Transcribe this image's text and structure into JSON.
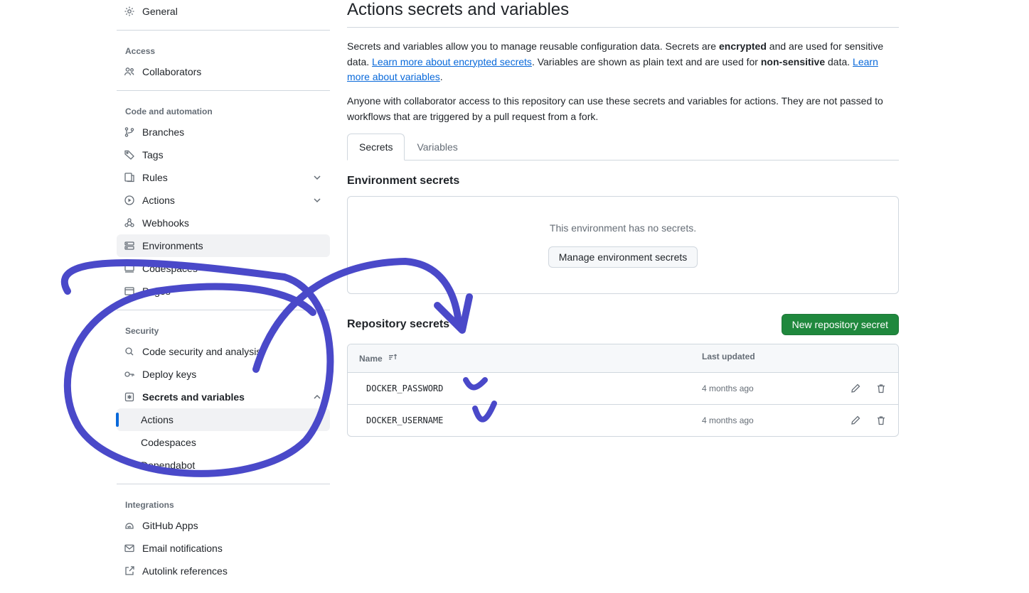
{
  "sidebar": {
    "general": "General",
    "access_heading": "Access",
    "collaborators": "Collaborators",
    "code_heading": "Code and automation",
    "branches": "Branches",
    "tags": "Tags",
    "rules": "Rules",
    "actions": "Actions",
    "webhooks": "Webhooks",
    "environments": "Environments",
    "codespaces": "Codespaces",
    "pages": "Pages",
    "security_heading": "Security",
    "code_security": "Code security and analysis",
    "deploy_keys": "Deploy keys",
    "secrets_vars": "Secrets and variables",
    "sub_actions": "Actions",
    "sub_codespaces": "Codespaces",
    "sub_dependabot": "Dependabot",
    "integrations_heading": "Integrations",
    "github_apps": "GitHub Apps",
    "email_notifications": "Email notifications",
    "autolink": "Autolink references"
  },
  "main": {
    "title": "Actions secrets and variables",
    "p1a": "Secrets and variables allow you to manage reusable configuration data. Secrets are ",
    "p1b_strong": "encrypted",
    "p1c": " and are used for sensitive data. ",
    "p1_link1": "Learn more about encrypted secrets",
    "p1d": ". Variables are shown as plain text and are used for ",
    "p1e_strong": "non-sensitive",
    "p1f": " data. ",
    "p1_link2": "Learn more about variables",
    "p1g": ".",
    "p2": "Anyone with collaborator access to this repository can use these secrets and variables for actions. They are not passed to workflows that are triggered by a pull request from a fork.",
    "tab_secrets": "Secrets",
    "tab_vars": "Variables",
    "env_heading": "Environment secrets",
    "env_empty": "This environment has no secrets.",
    "env_btn": "Manage environment secrets",
    "repo_heading": "Repository secrets",
    "new_secret_btn": "New repository secret",
    "th_name": "Name",
    "th_updated": "Last updated",
    "rows": [
      {
        "name": "DOCKER_PASSWORD",
        "updated": "4 months ago"
      },
      {
        "name": "DOCKER_USERNAME",
        "updated": "4 months ago"
      }
    ]
  }
}
